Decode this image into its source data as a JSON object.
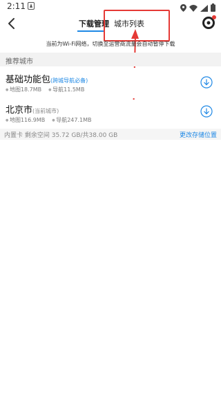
{
  "statusbar": {
    "time": "2:11"
  },
  "header": {
    "tabs": [
      {
        "label": "下载管理",
        "active": true
      },
      {
        "label": "城市列表",
        "active": false
      }
    ],
    "accent_color": "#1e88e5",
    "highlight_color": "#e53935"
  },
  "notice": "当前为Wi-Fi网络，切换至运营商流量会自动暂停下载",
  "section": {
    "title": "推荐城市"
  },
  "items": [
    {
      "name": "基础功能包",
      "tag": "(跨城导航必备)",
      "map_size": "地图18.7MB",
      "nav_size": "导航11.5MB"
    },
    {
      "name": "北京市",
      "tag": "(当前城市)",
      "map_size": "地图116.9MB",
      "nav_size": "导航247.1MB"
    }
  ],
  "storage": {
    "info": "内置卡 剩余空间 35.72 GB/共38.00 GB",
    "change_link": "更改存储位置"
  }
}
